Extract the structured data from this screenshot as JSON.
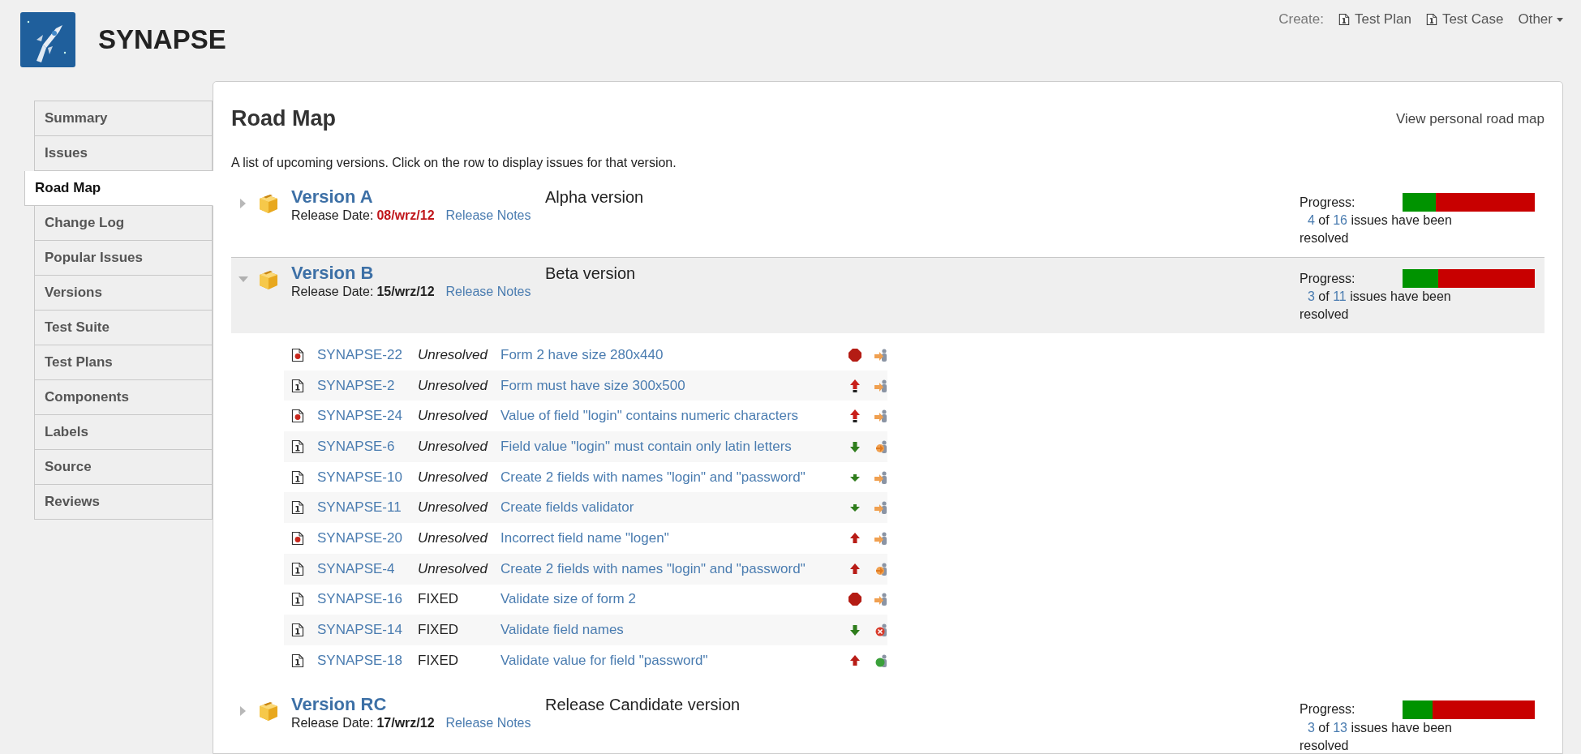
{
  "header": {
    "title": "SYNAPSE",
    "create_label": "Create:",
    "create_links": [
      {
        "label": "Test Plan"
      },
      {
        "label": "Test Case"
      }
    ],
    "other_menu": "Other"
  },
  "sidebar": {
    "items": [
      {
        "label": "Summary",
        "selected": false
      },
      {
        "label": "Issues",
        "selected": false
      },
      {
        "label": "Road Map",
        "selected": true
      },
      {
        "label": "Change Log",
        "selected": false
      },
      {
        "label": "Popular Issues",
        "selected": false
      },
      {
        "label": "Versions",
        "selected": false
      },
      {
        "label": "Test Suite",
        "selected": false
      },
      {
        "label": "Test Plans",
        "selected": false
      },
      {
        "label": "Components",
        "selected": false
      },
      {
        "label": "Labels",
        "selected": false
      },
      {
        "label": "Source",
        "selected": false
      },
      {
        "label": "Reviews",
        "selected": false
      }
    ]
  },
  "page": {
    "title": "Road Map",
    "personal_link": "View personal road map",
    "description": "A list of upcoming versions. Click on the row to display issues for that version."
  },
  "versions": [
    {
      "name": "Version A",
      "description": "Alpha version",
      "release_date_label": "Release Date:",
      "release_date": "08/wrz/12",
      "overdue": true,
      "release_notes": "Release Notes",
      "expanded": false,
      "progress": {
        "label": "Progress:",
        "level": 0.25,
        "resolved": "4",
        "of_text": "of",
        "total": "16",
        "suffix": "issues have been resolved"
      }
    },
    {
      "name": "Version B",
      "description": "Beta version",
      "release_date_label": "Release Date:",
      "release_date": "15/wrz/12",
      "overdue": false,
      "release_notes": "Release Notes",
      "expanded": true,
      "progress": {
        "label": "Progress:",
        "level": 0.27,
        "resolved": "3",
        "of_text": "of",
        "total": "11",
        "suffix": "issues have been resolved"
      },
      "issues": [
        {
          "type_icon": {
            "kind": "bug"
          },
          "key": "SYNAPSE-22",
          "status": "Unresolved",
          "resolved": false,
          "summary": "Form 2 have size 280x440",
          "priority_icon": {
            "kind": "blocker"
          },
          "state_icon": {
            "kind": "open"
          }
        },
        {
          "type_icon": {
            "kind": "task"
          },
          "key": "SYNAPSE-2",
          "status": "Unresolved",
          "resolved": false,
          "summary": "Form must have size 300x500",
          "priority_icon": {
            "kind": "critical"
          },
          "state_icon": {
            "kind": "open"
          }
        },
        {
          "type_icon": {
            "kind": "bug"
          },
          "key": "SYNAPSE-24",
          "status": "Unresolved",
          "resolved": false,
          "summary": "Value of field \"login\" contains numeric characters",
          "priority_icon": {
            "kind": "critical"
          },
          "state_icon": {
            "kind": "open"
          }
        },
        {
          "type_icon": {
            "kind": "task"
          },
          "key": "SYNAPSE-6",
          "status": "Unresolved",
          "resolved": false,
          "summary": "Field value \"login\" must contain only latin letters",
          "priority_icon": {
            "kind": "minor"
          },
          "state_icon": {
            "kind": "progress"
          }
        },
        {
          "type_icon": {
            "kind": "task"
          },
          "key": "SYNAPSE-10",
          "status": "Unresolved",
          "resolved": false,
          "summary": "Create 2 fields with names \"login\" and \"password\"",
          "priority_icon": {
            "kind": "trivial"
          },
          "state_icon": {
            "kind": "open"
          }
        },
        {
          "type_icon": {
            "kind": "task"
          },
          "key": "SYNAPSE-11",
          "status": "Unresolved",
          "resolved": false,
          "summary": "Create fields validator",
          "priority_icon": {
            "kind": "trivial"
          },
          "state_icon": {
            "kind": "open"
          }
        },
        {
          "type_icon": {
            "kind": "bug"
          },
          "key": "SYNAPSE-20",
          "status": "Unresolved",
          "resolved": false,
          "summary": "Incorrect field name \"logen\"",
          "priority_icon": {
            "kind": "major"
          },
          "state_icon": {
            "kind": "open"
          }
        },
        {
          "type_icon": {
            "kind": "task"
          },
          "key": "SYNAPSE-4",
          "status": "Unresolved",
          "resolved": false,
          "summary": "Create 2 fields with names \"login\" and \"password\"",
          "priority_icon": {
            "kind": "major"
          },
          "state_icon": {
            "kind": "progress"
          }
        },
        {
          "type_icon": {
            "kind": "task"
          },
          "key": "SYNAPSE-16",
          "status": "FIXED",
          "resolved": true,
          "summary": "Validate size of form 2",
          "priority_icon": {
            "kind": "blocker"
          },
          "state_icon": {
            "kind": "open"
          }
        },
        {
          "type_icon": {
            "kind": "task"
          },
          "key": "SYNAPSE-14",
          "status": "FIXED",
          "resolved": true,
          "summary": "Validate field names",
          "priority_icon": {
            "kind": "minor"
          },
          "state_icon": {
            "kind": "closed"
          }
        },
        {
          "type_icon": {
            "kind": "task"
          },
          "key": "SYNAPSE-18",
          "status": "FIXED",
          "resolved": true,
          "summary": "Validate value for field \"password\"",
          "priority_icon": {
            "kind": "major"
          },
          "state_icon": {
            "kind": "resolved"
          }
        }
      ]
    },
    {
      "name": "Version RC",
      "description": "Release Candidate version",
      "release_date_label": "Release Date:",
      "release_date": "17/wrz/12",
      "overdue": false,
      "release_notes": "Release Notes",
      "expanded": false,
      "progress": {
        "label": "Progress:",
        "level": 0.23,
        "resolved": "3",
        "of_text": "of",
        "total": "13",
        "suffix": "issues have been resolved"
      }
    }
  ]
}
